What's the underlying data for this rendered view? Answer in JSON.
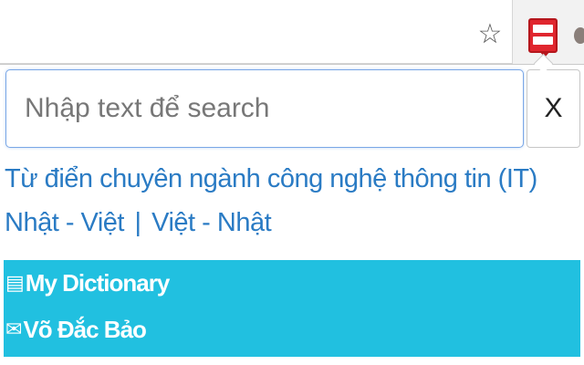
{
  "browser": {
    "star_icon": "star-outline-icon",
    "extension_icon": "dictionary-extension-icon"
  },
  "search": {
    "placeholder": "Nhập text để search",
    "value": "",
    "clear_label": "X"
  },
  "links": {
    "it_dictionary": "Từ điển chuyên ngành công nghệ thông tin (IT)",
    "ja_vi": "Nhật - Việt",
    "separator": "|",
    "vi_ja": "Việt - Nhật"
  },
  "footer": {
    "dictionary_label": "My Dictionary",
    "dictionary_icon": "list-icon",
    "author_label": "Võ Đắc Bảo",
    "author_icon": "envelope-icon",
    "background": "#21c0e0"
  },
  "colors": {
    "link": "#2a7bc4",
    "accent_border": "#7aa7e6",
    "extension_red": "#e0262e"
  }
}
